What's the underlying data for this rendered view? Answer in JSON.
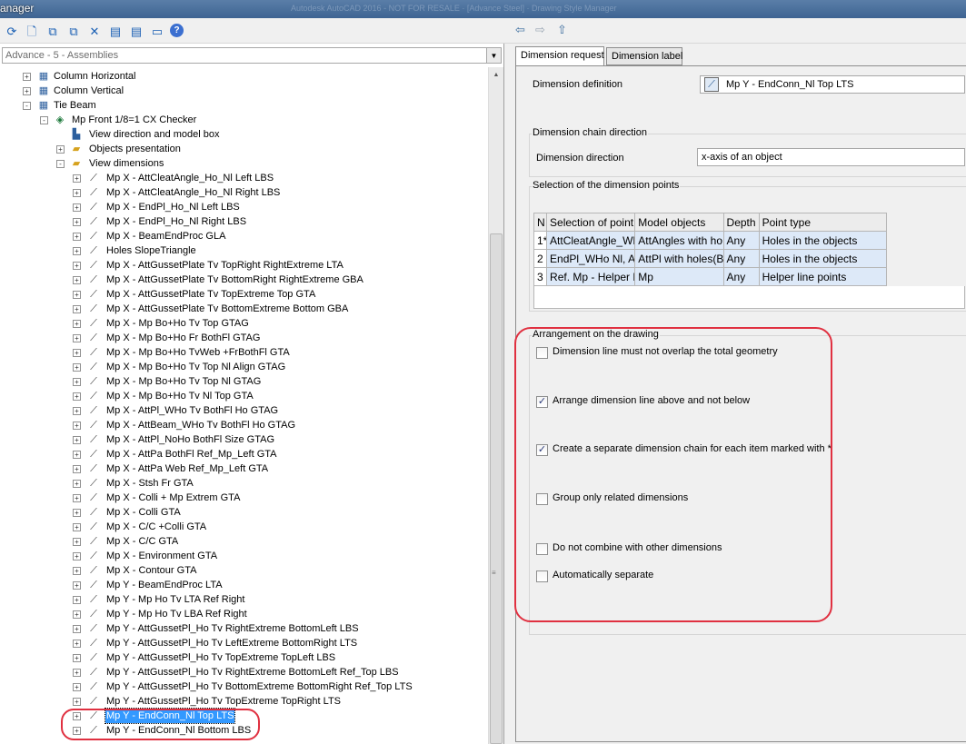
{
  "window": {
    "title": "anager",
    "subtitle": "Autodesk AutoCAD 2016 - NOT FOR RESALE  ·  [Advance Steel]  ·  Drawing Style Manager"
  },
  "toolbar": {
    "icons": [
      "new-style-icon",
      "copy-icon",
      "paste-icon",
      "clone-icon",
      "delete-icon",
      "import-icon",
      "export-icon",
      "preview-icon",
      "help-icon"
    ],
    "glyphs": [
      "⟳",
      "🗋",
      "⧉",
      "⧉",
      "✕",
      "▤",
      "▤",
      "▭",
      "?"
    ]
  },
  "nav": {
    "back": "⇦",
    "forward": "⇨",
    "up": "⇧"
  },
  "left": {
    "combo_value": "Advance - 5 - Assemblies",
    "tree": [
      {
        "level": 2,
        "icon": "grp",
        "label": "Column Horizontal",
        "expander": "+"
      },
      {
        "level": 2,
        "icon": "grp",
        "label": "Column Vertical",
        "expander": "+"
      },
      {
        "level": 2,
        "icon": "grp",
        "label": "Tie Beam",
        "expander": "-"
      },
      {
        "level": 3,
        "icon": "obj",
        "label": "Mp Front 1/8=1 CX Checker",
        "expander": "-"
      },
      {
        "level": 4,
        "icon": "box",
        "label": "View direction and model box",
        "expander": ""
      },
      {
        "level": 4,
        "icon": "folder",
        "label": "Objects presentation",
        "expander": "+"
      },
      {
        "level": 4,
        "icon": "folder",
        "label": "View dimensions",
        "expander": "-"
      },
      {
        "level": 5,
        "icon": "dim",
        "label": "Mp X - AttCleatAngle_Ho_Nl Left LBS",
        "expander": "+"
      },
      {
        "level": 5,
        "icon": "dim",
        "label": "Mp X - AttCleatAngle_Ho_Nl Right LBS",
        "expander": "+"
      },
      {
        "level": 5,
        "icon": "dim",
        "label": "Mp X - EndPl_Ho_Nl Left LBS",
        "expander": "+"
      },
      {
        "level": 5,
        "icon": "dim",
        "label": "Mp X - EndPl_Ho_Nl Right LBS",
        "expander": "+"
      },
      {
        "level": 5,
        "icon": "dim",
        "label": "Mp X - BeamEndProc GLA",
        "expander": "+"
      },
      {
        "level": 5,
        "icon": "dim",
        "label": "Holes SlopeTriangle",
        "expander": "+"
      },
      {
        "level": 5,
        "icon": "dim",
        "label": "Mp X - AttGussetPlate Tv TopRight RightExtreme LTA",
        "expander": "+"
      },
      {
        "level": 5,
        "icon": "dim",
        "label": "Mp X - AttGussetPlate Tv BottomRight RightExtreme GBA",
        "expander": "+"
      },
      {
        "level": 5,
        "icon": "dim",
        "label": "Mp X - AttGussetPlate Tv TopExtreme Top GTA",
        "expander": "+"
      },
      {
        "level": 5,
        "icon": "dim",
        "label": "Mp X - AttGussetPlate Tv BottomExtreme Bottom GBA",
        "expander": "+"
      },
      {
        "level": 5,
        "icon": "dim",
        "label": "Mp X - Mp Bo+Ho Tv Top GTAG",
        "expander": "+"
      },
      {
        "level": 5,
        "icon": "dim",
        "label": "Mp X - Mp Bo+Ho Fr BothFl GTAG",
        "expander": "+"
      },
      {
        "level": 5,
        "icon": "dim",
        "label": "Mp X - Mp Bo+Ho TvWeb +FrBothFl GTA",
        "expander": "+"
      },
      {
        "level": 5,
        "icon": "dim",
        "label": "Mp X - Mp Bo+Ho Tv Top Nl Align GTAG",
        "expander": "+"
      },
      {
        "level": 5,
        "icon": "dim",
        "label": "Mp X - Mp Bo+Ho Tv Top Nl GTAG",
        "expander": "+"
      },
      {
        "level": 5,
        "icon": "dim",
        "label": "Mp X - Mp Bo+Ho Tv Nl Top GTA",
        "expander": "+"
      },
      {
        "level": 5,
        "icon": "dim",
        "label": "Mp X - AttPl_WHo Tv BothFl Ho GTAG",
        "expander": "+"
      },
      {
        "level": 5,
        "icon": "dim",
        "label": "Mp X - AttBeam_WHo Tv BothFl Ho GTAG",
        "expander": "+"
      },
      {
        "level": 5,
        "icon": "dim",
        "label": "Mp X - AttPl_NoHo BothFl Size GTAG",
        "expander": "+"
      },
      {
        "level": 5,
        "icon": "dim",
        "label": "Mp X - AttPa BothFl Ref_Mp_Left GTA",
        "expander": "+"
      },
      {
        "level": 5,
        "icon": "dim",
        "label": "Mp X - AttPa Web Ref_Mp_Left GTA",
        "expander": "+"
      },
      {
        "level": 5,
        "icon": "dim",
        "label": "Mp X - Stsh Fr GTA",
        "expander": "+"
      },
      {
        "level": 5,
        "icon": "dim",
        "label": "Mp X - Colli + Mp Extrem GTA",
        "expander": "+"
      },
      {
        "level": 5,
        "icon": "dim",
        "label": "Mp X - Colli GTA",
        "expander": "+"
      },
      {
        "level": 5,
        "icon": "dim",
        "label": "Mp X - C/C +Colli GTA",
        "expander": "+"
      },
      {
        "level": 5,
        "icon": "dim",
        "label": "Mp X - C/C GTA",
        "expander": "+"
      },
      {
        "level": 5,
        "icon": "dim",
        "label": "Mp X - Environment GTA",
        "expander": "+"
      },
      {
        "level": 5,
        "icon": "dim",
        "label": "Mp X - Contour GTA",
        "expander": "+"
      },
      {
        "level": 5,
        "icon": "dim",
        "label": "Mp Y - BeamEndProc LTA",
        "expander": "+"
      },
      {
        "level": 5,
        "icon": "dim",
        "label": "Mp Y - Mp Ho Tv LTA Ref Right",
        "expander": "+"
      },
      {
        "level": 5,
        "icon": "dim",
        "label": "Mp Y - Mp Ho Tv LBA Ref Right",
        "expander": "+"
      },
      {
        "level": 5,
        "icon": "dim",
        "label": "Mp Y - AttGussetPl_Ho Tv RightExtreme BottomLeft LBS",
        "expander": "+"
      },
      {
        "level": 5,
        "icon": "dim",
        "label": "Mp Y - AttGussetPl_Ho Tv LeftExtreme BottomRight LTS",
        "expander": "+"
      },
      {
        "level": 5,
        "icon": "dim",
        "label": "Mp Y - AttGussetPl_Ho Tv TopExtreme TopLeft LBS",
        "expander": "+"
      },
      {
        "level": 5,
        "icon": "dim",
        "label": "Mp Y - AttGussetPl_Ho Tv RightExtreme BottomLeft Ref_Top LBS",
        "expander": "+"
      },
      {
        "level": 5,
        "icon": "dim",
        "label": "Mp Y - AttGussetPl_Ho Tv BottomExtreme BottomRight Ref_Top LTS",
        "expander": "+"
      },
      {
        "level": 5,
        "icon": "dim",
        "label": "Mp Y - AttGussetPl_Ho Tv TopExtreme TopRight LTS",
        "expander": "+"
      },
      {
        "level": 5,
        "icon": "dim",
        "label": "Mp Y - EndConn_Nl Top  LTS",
        "expander": "+",
        "selected": true
      },
      {
        "level": 5,
        "icon": "dim",
        "label": "Mp Y - EndConn_Nl Bottom  LBS",
        "expander": "+"
      }
    ]
  },
  "right": {
    "tabs": [
      {
        "label": "Dimension request",
        "active": true
      },
      {
        "label": "Dimension label",
        "active": false
      }
    ],
    "dimension_definition": {
      "label": "Dimension definition",
      "value": "Mp Y - EndConn_Nl Top  LTS"
    },
    "chain_direction": {
      "caption": "Dimension chain direction",
      "label": "Dimension direction",
      "value": "x-axis of an object"
    },
    "points": {
      "caption": "Selection of the dimension points",
      "columns": [
        "N",
        "Selection of point",
        "Model objects",
        "Depth",
        "Point type"
      ],
      "rows": [
        [
          "1*",
          "AttCleatAngle_WHo",
          "AttAngles with ho",
          "Any",
          "Holes in the objects"
        ],
        [
          "2",
          "EndPl_WHo Nl, Ar",
          "AttPl with holes(B",
          "Any",
          "Holes in the objects"
        ],
        [
          "3",
          "Ref. Mp - Helper L",
          "Mp",
          "Any",
          "Helper line points"
        ]
      ]
    },
    "arrangement": {
      "caption": "Arrangement on the drawing",
      "options": [
        {
          "label": "Dimension line must not overlap the total geometry",
          "checked": false
        },
        {
          "label": "Arrange dimension line above and not below",
          "checked": true
        },
        {
          "label": "Create a separate dimension chain for each item marked with *",
          "checked": true
        },
        {
          "label": "Group only related dimensions",
          "checked": false
        },
        {
          "label": "Do not combine with other dimensions",
          "checked": false
        },
        {
          "label": "Automatically separate",
          "checked": false
        }
      ]
    }
  },
  "colors": {
    "selection": "#3399ff",
    "callout": "#e03040",
    "table_selected": "#dde9f8"
  }
}
